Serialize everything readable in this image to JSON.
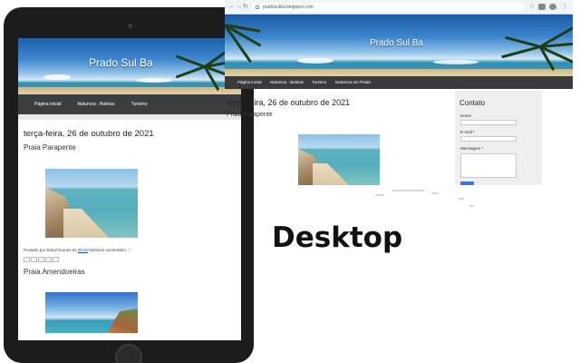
{
  "tablet": {
    "blog_title": "Prado Sul Ba",
    "nav": [
      "Página inicial",
      "Natureza - Baleias",
      "Turismo"
    ],
    "date_header": "terça-feira, 26 de outubro de 2021",
    "post1_title": "Praia Parapente",
    "post_meta": {
      "prefix": "Postado por Edval Gomes às ",
      "time": "09:26",
      "suffix": " Nenhum comentário:",
      "edit_icon": "pencil-icon"
    },
    "share_icons": [
      "email-icon",
      "blog-icon",
      "twitter-icon",
      "facebook-icon",
      "pinterest-icon"
    ],
    "post2_title": "Praia Amendoeiras"
  },
  "browser": {
    "url": "pradosulba.blogspot.com",
    "icons": [
      "back-icon",
      "forward-icon",
      "reload-icon",
      "lock-icon",
      "star-icon",
      "extensions-icon",
      "profile-icon",
      "menu-icon"
    ]
  },
  "desktop": {
    "blog_title": "Prado Sul Ba",
    "nav": [
      "Página inicial",
      "Natureza - Baleias",
      "Turismo",
      "Natureza em Prado"
    ],
    "date_header": "terça-feira, 26 de outubro de 2021",
    "post1_title": "Praia Parapente",
    "sidebar": {
      "title": "Contato",
      "name_label": "Nome",
      "email_label": "E-mail *",
      "message_label": "Mensagem *"
    }
  },
  "caption": "Desktop",
  "colors": {
    "nav_bg": "#3a3a3a",
    "tablet_frame": "#1c1c1c",
    "send_button": "#3a74d6"
  }
}
